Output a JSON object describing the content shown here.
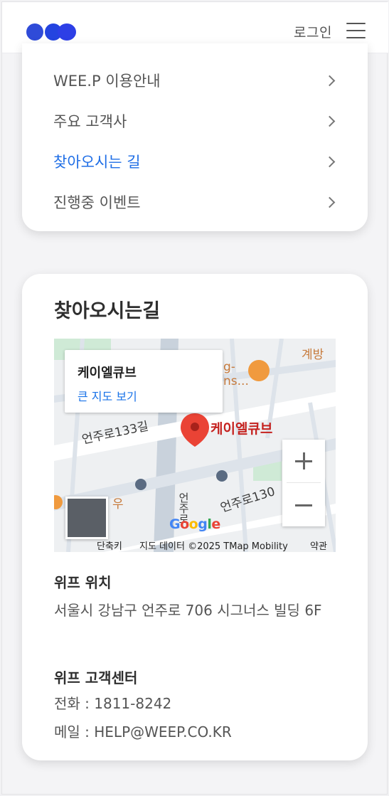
{
  "header": {
    "login_label": "로그인",
    "logo_icon": "weep-logo-icon",
    "menu_icon": "hamburger-menu-icon",
    "brand_color": "#2f4bd8"
  },
  "nav": {
    "items": [
      {
        "label": "WEE.P 이용안내",
        "active": false
      },
      {
        "label": "주요 고객사",
        "active": false
      },
      {
        "label": "찾아오시는 길",
        "active": true
      },
      {
        "label": "진행중 이벤트",
        "active": false
      }
    ],
    "active_color": "#1f6ee6"
  },
  "location": {
    "title": "찾아오시는길",
    "map": {
      "place_name": "케이엘큐브",
      "view_larger_label": "큰 지도 보기",
      "pin_label": "케이엘큐브",
      "streets": [
        "언주로133길",
        "언주로130",
        "언주로",
        "계방"
      ],
      "poi_labels": [
        "g-",
        "ns...",
        "우"
      ],
      "zoom_in": "+",
      "zoom_out": "−",
      "attribution": {
        "shortcut": "단축키",
        "data": "지도 데이터 ©2025 TMap Mobility",
        "terms": "약관"
      },
      "google_logo": "Google"
    },
    "wep_location": {
      "heading": "위프 위치",
      "address": "서울시 강남구 언주로 706 시그너스 빌딩 6F"
    },
    "customer_center": {
      "heading": "위프 고객센터",
      "phone": "전화 : 1811-8242",
      "email": "메일 : HELP@WEEP.CO.KR"
    }
  }
}
